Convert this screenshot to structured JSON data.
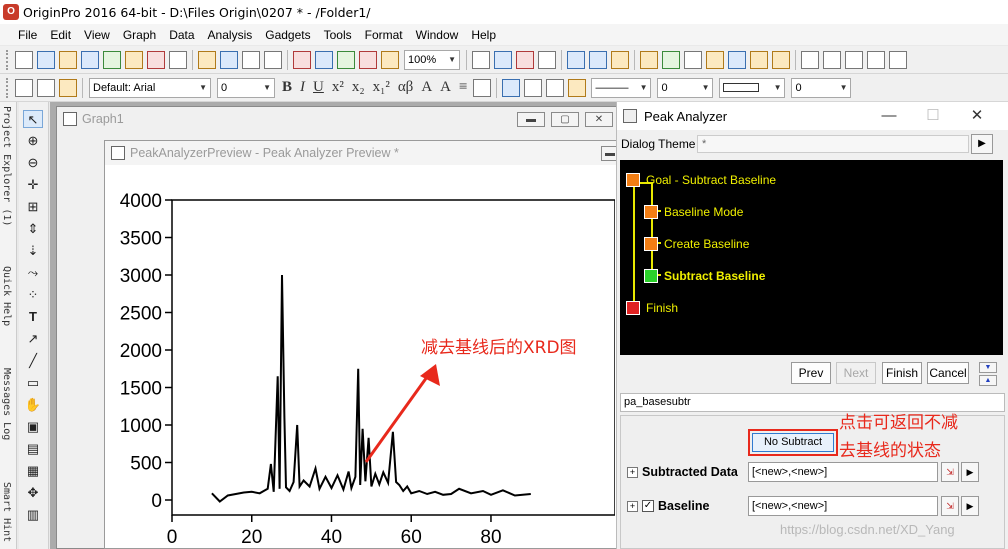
{
  "title_bar": {
    "text": "OriginPro 2016 64-bit - D:\\Files Origin\\0207 * - /Folder1/"
  },
  "menu": [
    "File",
    "Edit",
    "View",
    "Graph",
    "Data",
    "Analysis",
    "Gadgets",
    "Tools",
    "Format",
    "Window",
    "Help"
  ],
  "toolbar": {
    "zoom": "100%",
    "font": "Default: Arial",
    "font_size": "0",
    "fmt_buttons": [
      "B",
      "I",
      "U",
      "x²",
      "x₂",
      "x₁²",
      "αβ",
      "A",
      "A",
      "≡"
    ],
    "line_width": "0",
    "fill_width": "0"
  },
  "side_tabs": [
    "Project Explorer (1)",
    "Quick Help",
    "Messages Log",
    "Smart Hint"
  ],
  "graph_window": {
    "title": "Graph1"
  },
  "preview_window": {
    "title": "PeakAnalyzerPreview - Peak Analyzer Preview *"
  },
  "chart_data": {
    "type": "line",
    "title": "",
    "xlabel": "",
    "ylabel": "",
    "xlim": [
      0,
      100
    ],
    "ylim": [
      -200,
      4000
    ],
    "x_ticks": [
      0,
      20,
      40,
      60,
      80
    ],
    "y_ticks": [
      0,
      500,
      1000,
      1500,
      2000,
      2500,
      3000,
      3500,
      4000
    ],
    "series": [
      {
        "x": [
          10,
          12,
          14,
          16,
          18,
          20,
          22,
          23,
          24,
          24.8,
          25.5,
          26.5,
          27,
          27.6,
          28.2,
          28.6,
          29.5,
          30.5,
          31.4,
          32,
          33,
          34.5,
          36,
          37,
          38.5,
          40,
          41.5,
          43,
          44.3,
          45,
          46,
          46.7,
          47.2,
          47.8,
          48.5,
          49.3,
          50,
          51,
          52,
          53,
          54.2,
          55.4,
          56.2,
          57,
          58,
          59,
          60,
          62,
          64,
          66,
          68,
          70,
          72,
          75,
          78,
          80,
          83,
          86,
          90
        ],
        "y": [
          90,
          -20,
          60,
          80,
          100,
          110,
          90,
          120,
          150,
          480,
          110,
          1650,
          150,
          3000,
          1100,
          170,
          120,
          240,
          1000,
          180,
          260,
          180,
          420,
          150,
          310,
          160,
          330,
          140,
          380,
          160,
          310,
          1750,
          200,
          950,
          250,
          830,
          180,
          350,
          210,
          370,
          230,
          910,
          240,
          200,
          120,
          180,
          90,
          120,
          80,
          110,
          70,
          80,
          150,
          90,
          120,
          70,
          130,
          60,
          80
        ]
      }
    ],
    "grid": false,
    "legend": "none"
  },
  "annotations": {
    "xrd_label": "减去基线后的XRD图",
    "nosub_line1": "点击可返回不减",
    "nosub_line2": "去基线的状态"
  },
  "peak_analyzer": {
    "title": "Peak Analyzer",
    "dialog_theme_label": "Dialog Theme",
    "dialog_theme_value": "*",
    "goals": [
      {
        "label": "Goal - Subtract Baseline",
        "status": "orange",
        "bold": false
      },
      {
        "label": "Baseline Mode",
        "status": "orange",
        "bold": false
      },
      {
        "label": "Create Baseline",
        "status": "orange",
        "bold": false
      },
      {
        "label": "Subtract Baseline",
        "status": "green",
        "bold": true
      },
      {
        "label": "Finish",
        "status": "red",
        "bold": false
      }
    ],
    "buttons": {
      "prev": "Prev",
      "next": "Next",
      "finish": "Finish",
      "cancel": "Cancel"
    },
    "page_name": "pa_basesubtr",
    "no_subtract": "No Subtract",
    "subtracted_data_label": "Subtracted Data",
    "subtracted_data_value": "[<new>,<new>]",
    "baseline_label": "Baseline",
    "baseline_value": "[<new>,<new>]"
  },
  "watermark": "https://blog.csdn.net/XD_Yang"
}
